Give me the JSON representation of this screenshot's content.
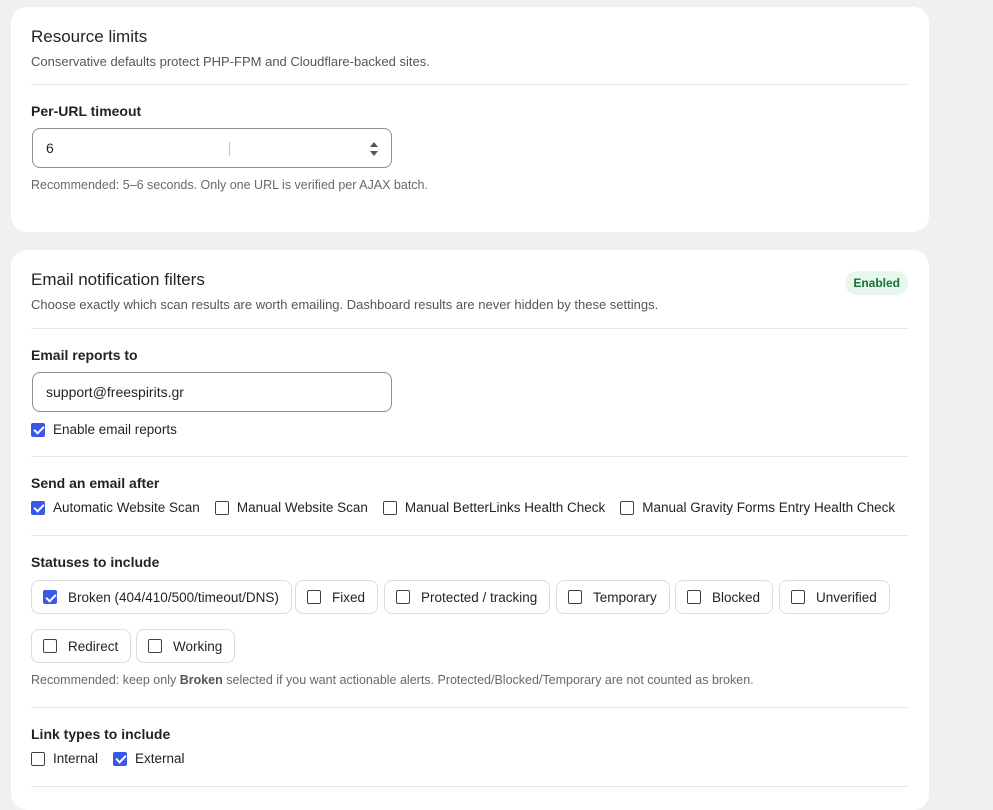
{
  "resource": {
    "title": "Resource limits",
    "description": "Conservative defaults protect PHP-FPM and Cloudflare-backed sites.",
    "timeout_label": "Per-URL timeout",
    "timeout_value": "6",
    "timeout_help": "Recommended: 5–6 seconds. Only one URL is verified per AJAX batch."
  },
  "email": {
    "title": "Email notification filters",
    "description": "Choose exactly which scan results are worth emailing. Dashboard results are never hidden by these settings.",
    "badge": "Enabled",
    "reports_to_label": "Email reports to",
    "reports_to_value": "support@freespirits.gr",
    "enable_label": "Enable email reports",
    "enable_checked": true,
    "send_after": {
      "label": "Send an email after",
      "options": [
        {
          "label": "Automatic Website Scan",
          "checked": true
        },
        {
          "label": "Manual Website Scan",
          "checked": false
        },
        {
          "label": "Manual BetterLinks Health Check",
          "checked": false
        },
        {
          "label": "Manual Gravity Forms Entry Health Check",
          "checked": false
        }
      ]
    },
    "statuses": {
      "label": "Statuses to include",
      "options": [
        {
          "label": "Broken (404/410/500/timeout/DNS)",
          "checked": true
        },
        {
          "label": "Fixed",
          "checked": false
        },
        {
          "label": "Protected / tracking",
          "checked": false
        },
        {
          "label": "Temporary",
          "checked": false
        },
        {
          "label": "Blocked",
          "checked": false
        },
        {
          "label": "Unverified",
          "checked": false
        },
        {
          "label": "Redirect",
          "checked": false
        },
        {
          "label": "Working",
          "checked": false
        }
      ],
      "help_prefix": "Recommended: keep only ",
      "help_bold": "Broken",
      "help_suffix": " selected if you want actionable alerts. Protected/Blocked/Temporary are not counted as broken."
    },
    "link_types": {
      "label": "Link types to include",
      "options": [
        {
          "label": "Internal",
          "checked": false
        },
        {
          "label": "External",
          "checked": true
        }
      ]
    }
  }
}
